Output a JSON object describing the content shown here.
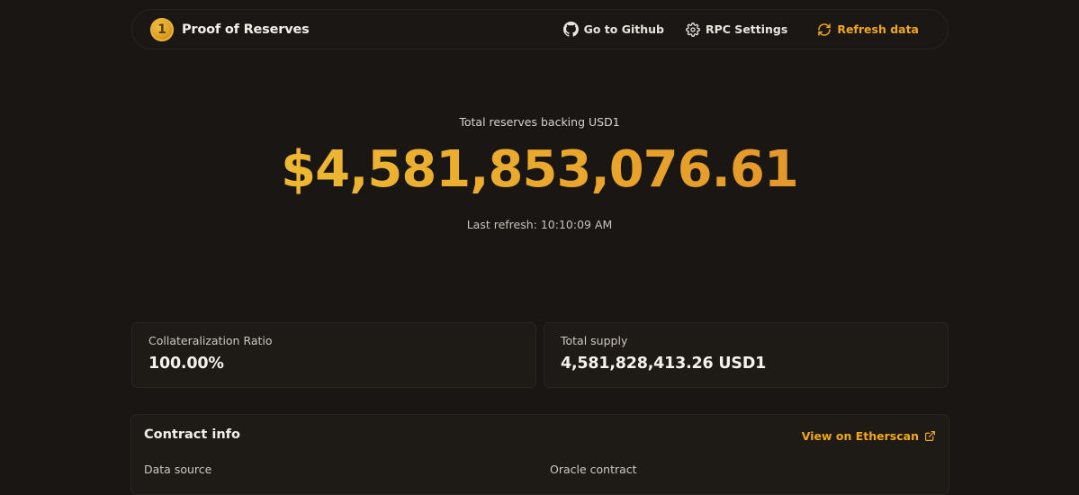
{
  "header": {
    "logo_glyph": "1",
    "brand": "Proof of Reserves",
    "links": {
      "github": "Go to Github",
      "rpc": "RPC Settings",
      "refresh": "Refresh data"
    },
    "accent_color": "#f1a81c"
  },
  "hero": {
    "label": "Total reserves backing USD1",
    "value": "$4,581,853,076.61",
    "last_refresh": "Last refresh: 10:10:09 AM"
  },
  "cards": {
    "collateral": {
      "label": "Collateralization Ratio",
      "value": "100.00%"
    },
    "supply": {
      "label": "Total supply",
      "value": "4,581,828,413.26 USD1"
    }
  },
  "contract": {
    "title": "Contract info",
    "etherscan": "View on Etherscan",
    "data_source_label": "Data source",
    "oracle_label": "Oracle contract"
  },
  "icons": {
    "github": "github-icon",
    "settings": "gear-icon",
    "refresh": "refresh-icon",
    "external": "external-link-icon"
  }
}
